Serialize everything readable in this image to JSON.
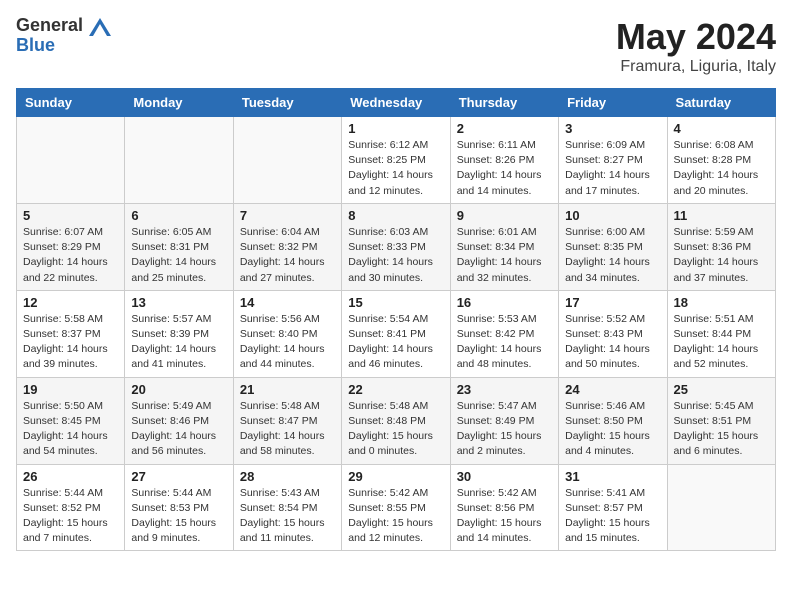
{
  "header": {
    "logo_general": "General",
    "logo_blue": "Blue",
    "title": "May 2024",
    "location": "Framura, Liguria, Italy"
  },
  "days_of_week": [
    "Sunday",
    "Monday",
    "Tuesday",
    "Wednesday",
    "Thursday",
    "Friday",
    "Saturday"
  ],
  "weeks": [
    [
      {
        "day": "",
        "info": ""
      },
      {
        "day": "",
        "info": ""
      },
      {
        "day": "",
        "info": ""
      },
      {
        "day": "1",
        "info": "Sunrise: 6:12 AM\nSunset: 8:25 PM\nDaylight: 14 hours\nand 12 minutes."
      },
      {
        "day": "2",
        "info": "Sunrise: 6:11 AM\nSunset: 8:26 PM\nDaylight: 14 hours\nand 14 minutes."
      },
      {
        "day": "3",
        "info": "Sunrise: 6:09 AM\nSunset: 8:27 PM\nDaylight: 14 hours\nand 17 minutes."
      },
      {
        "day": "4",
        "info": "Sunrise: 6:08 AM\nSunset: 8:28 PM\nDaylight: 14 hours\nand 20 minutes."
      }
    ],
    [
      {
        "day": "5",
        "info": "Sunrise: 6:07 AM\nSunset: 8:29 PM\nDaylight: 14 hours\nand 22 minutes."
      },
      {
        "day": "6",
        "info": "Sunrise: 6:05 AM\nSunset: 8:31 PM\nDaylight: 14 hours\nand 25 minutes."
      },
      {
        "day": "7",
        "info": "Sunrise: 6:04 AM\nSunset: 8:32 PM\nDaylight: 14 hours\nand 27 minutes."
      },
      {
        "day": "8",
        "info": "Sunrise: 6:03 AM\nSunset: 8:33 PM\nDaylight: 14 hours\nand 30 minutes."
      },
      {
        "day": "9",
        "info": "Sunrise: 6:01 AM\nSunset: 8:34 PM\nDaylight: 14 hours\nand 32 minutes."
      },
      {
        "day": "10",
        "info": "Sunrise: 6:00 AM\nSunset: 8:35 PM\nDaylight: 14 hours\nand 34 minutes."
      },
      {
        "day": "11",
        "info": "Sunrise: 5:59 AM\nSunset: 8:36 PM\nDaylight: 14 hours\nand 37 minutes."
      }
    ],
    [
      {
        "day": "12",
        "info": "Sunrise: 5:58 AM\nSunset: 8:37 PM\nDaylight: 14 hours\nand 39 minutes."
      },
      {
        "day": "13",
        "info": "Sunrise: 5:57 AM\nSunset: 8:39 PM\nDaylight: 14 hours\nand 41 minutes."
      },
      {
        "day": "14",
        "info": "Sunrise: 5:56 AM\nSunset: 8:40 PM\nDaylight: 14 hours\nand 44 minutes."
      },
      {
        "day": "15",
        "info": "Sunrise: 5:54 AM\nSunset: 8:41 PM\nDaylight: 14 hours\nand 46 minutes."
      },
      {
        "day": "16",
        "info": "Sunrise: 5:53 AM\nSunset: 8:42 PM\nDaylight: 14 hours\nand 48 minutes."
      },
      {
        "day": "17",
        "info": "Sunrise: 5:52 AM\nSunset: 8:43 PM\nDaylight: 14 hours\nand 50 minutes."
      },
      {
        "day": "18",
        "info": "Sunrise: 5:51 AM\nSunset: 8:44 PM\nDaylight: 14 hours\nand 52 minutes."
      }
    ],
    [
      {
        "day": "19",
        "info": "Sunrise: 5:50 AM\nSunset: 8:45 PM\nDaylight: 14 hours\nand 54 minutes."
      },
      {
        "day": "20",
        "info": "Sunrise: 5:49 AM\nSunset: 8:46 PM\nDaylight: 14 hours\nand 56 minutes."
      },
      {
        "day": "21",
        "info": "Sunrise: 5:48 AM\nSunset: 8:47 PM\nDaylight: 14 hours\nand 58 minutes."
      },
      {
        "day": "22",
        "info": "Sunrise: 5:48 AM\nSunset: 8:48 PM\nDaylight: 15 hours\nand 0 minutes."
      },
      {
        "day": "23",
        "info": "Sunrise: 5:47 AM\nSunset: 8:49 PM\nDaylight: 15 hours\nand 2 minutes."
      },
      {
        "day": "24",
        "info": "Sunrise: 5:46 AM\nSunset: 8:50 PM\nDaylight: 15 hours\nand 4 minutes."
      },
      {
        "day": "25",
        "info": "Sunrise: 5:45 AM\nSunset: 8:51 PM\nDaylight: 15 hours\nand 6 minutes."
      }
    ],
    [
      {
        "day": "26",
        "info": "Sunrise: 5:44 AM\nSunset: 8:52 PM\nDaylight: 15 hours\nand 7 minutes."
      },
      {
        "day": "27",
        "info": "Sunrise: 5:44 AM\nSunset: 8:53 PM\nDaylight: 15 hours\nand 9 minutes."
      },
      {
        "day": "28",
        "info": "Sunrise: 5:43 AM\nSunset: 8:54 PM\nDaylight: 15 hours\nand 11 minutes."
      },
      {
        "day": "29",
        "info": "Sunrise: 5:42 AM\nSunset: 8:55 PM\nDaylight: 15 hours\nand 12 minutes."
      },
      {
        "day": "30",
        "info": "Sunrise: 5:42 AM\nSunset: 8:56 PM\nDaylight: 15 hours\nand 14 minutes."
      },
      {
        "day": "31",
        "info": "Sunrise: 5:41 AM\nSunset: 8:57 PM\nDaylight: 15 hours\nand 15 minutes."
      },
      {
        "day": "",
        "info": ""
      }
    ]
  ]
}
